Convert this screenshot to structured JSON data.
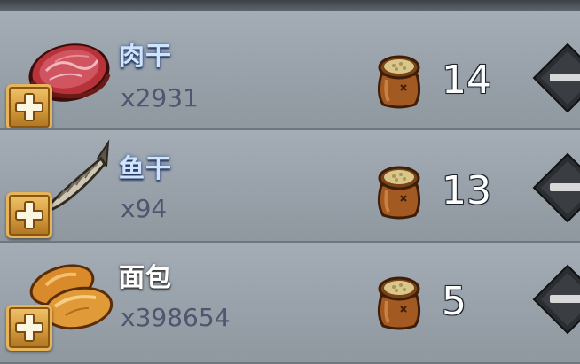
{
  "items": [
    {
      "name": "肉干",
      "count": "x2931",
      "price": "14",
      "icon": "dried-meat-icon"
    },
    {
      "name": "鱼干",
      "count": "x94",
      "price": "13",
      "icon": "dried-fish-icon"
    },
    {
      "name": "面包",
      "count": "x398654",
      "price": "5",
      "icon": "bread-icon"
    }
  ],
  "icons": {
    "currency": "grain-sack-icon",
    "add": "plus-icon",
    "remove": "minus-icon"
  },
  "colors": {
    "accent_button": "#d39a3a",
    "item_name_blue": "#cfe4ff",
    "item_name_white": "#ffffff",
    "count_text": "#4f5670"
  }
}
